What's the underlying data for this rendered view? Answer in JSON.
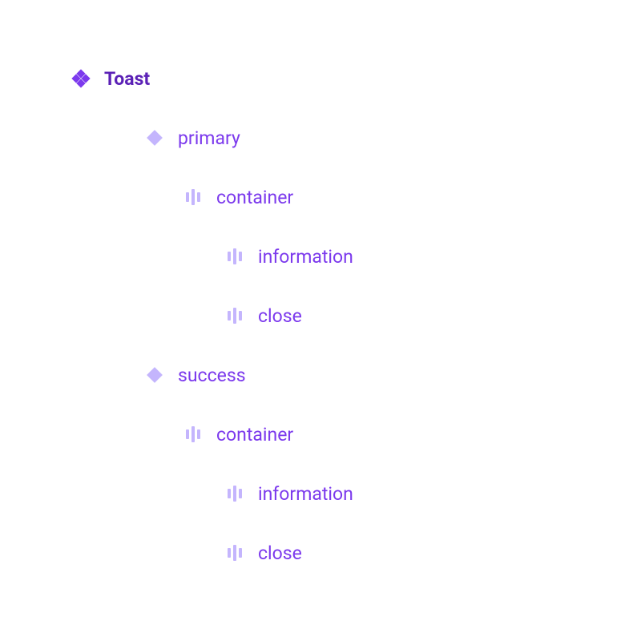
{
  "tree": {
    "root": {
      "label": "Toast",
      "icon": "component-set-icon"
    },
    "variants": [
      {
        "label": "primary",
        "icon": "variant-icon",
        "children": [
          {
            "label": "container",
            "icon": "frame-icon",
            "children": [
              {
                "label": "information",
                "icon": "frame-icon"
              },
              {
                "label": "close",
                "icon": "frame-icon"
              }
            ]
          }
        ]
      },
      {
        "label": "success",
        "icon": "variant-icon",
        "children": [
          {
            "label": "container",
            "icon": "frame-icon",
            "children": [
              {
                "label": "information",
                "icon": "frame-icon"
              },
              {
                "label": "close",
                "icon": "frame-icon"
              }
            ]
          }
        ]
      }
    ]
  }
}
